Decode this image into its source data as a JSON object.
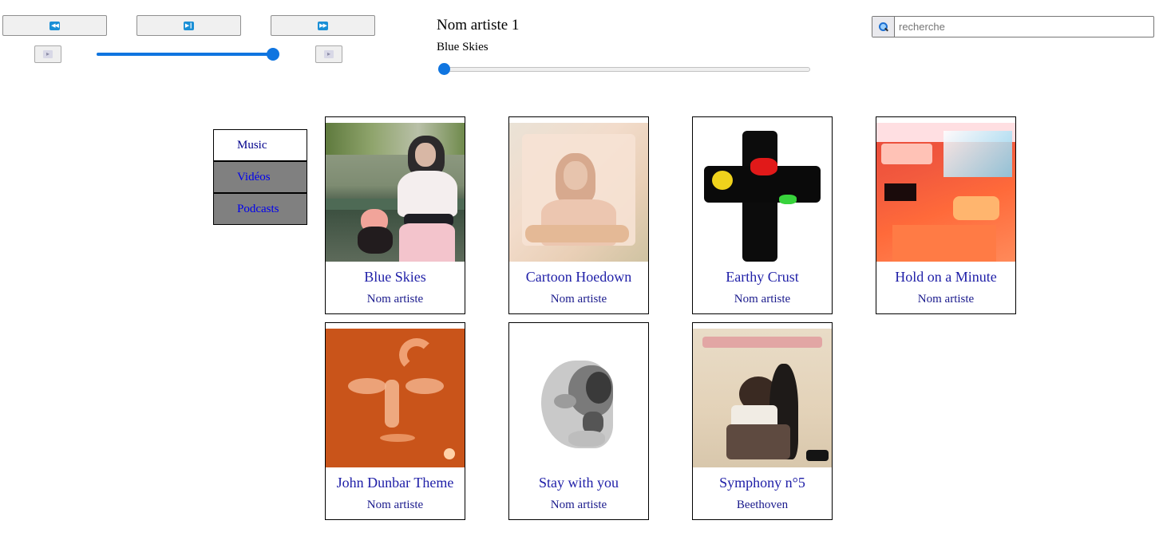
{
  "player": {
    "prev_icon": "skip-previous-icon",
    "play_pause_icon": "play-pause-icon",
    "next_icon": "skip-next-icon",
    "volume_down_icon": "volume-down-icon",
    "volume_up_icon": "volume-up-icon",
    "volume_level": 1.0,
    "artist": "Nom artiste 1",
    "track": "Blue Skies",
    "progress": 0.0,
    "accent_color": "#0f75e0"
  },
  "search": {
    "placeholder": "recherche",
    "value": "",
    "icon": "search-icon"
  },
  "nav": {
    "items": [
      {
        "label": "Music",
        "active": true
      },
      {
        "label": "Vidéos",
        "active": false
      },
      {
        "label": "Podcasts",
        "active": false
      }
    ]
  },
  "cards": [
    {
      "title": "Blue Skies",
      "artist": "Nom artiste",
      "cover": "album-cover-image"
    },
    {
      "title": "Cartoon Hoedown",
      "artist": "Nom artiste",
      "cover": "album-cover-image"
    },
    {
      "title": "Earthy Crust",
      "artist": "Nom artiste",
      "cover": "album-cover-image"
    },
    {
      "title": "Hold on a Minute",
      "artist": "Nom artiste",
      "cover": "album-cover-image"
    },
    {
      "title": "John Dunbar Theme",
      "artist": "Nom artiste",
      "cover": "album-cover-image"
    },
    {
      "title": "Stay with you",
      "artist": "Nom artiste",
      "cover": "album-cover-image"
    },
    {
      "title": "Symphony n°5",
      "artist": "Beethoven",
      "cover": "album-cover-image"
    }
  ]
}
